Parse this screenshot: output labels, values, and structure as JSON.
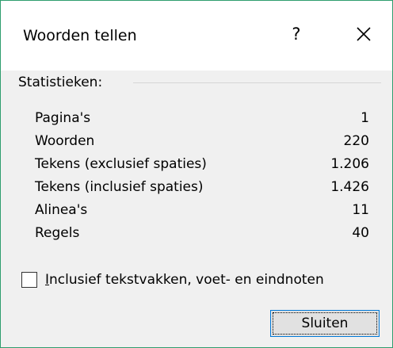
{
  "window": {
    "title": "Woorden tellen",
    "help_label": "?",
    "close_icon": "close-icon"
  },
  "statistics": {
    "heading": "Statistieken:",
    "rows": [
      {
        "label": "Pagina's",
        "value": "1"
      },
      {
        "label": "Woorden",
        "value": "220"
      },
      {
        "label": "Tekens (exclusief spaties)",
        "value": "1.206"
      },
      {
        "label": "Tekens (inclusief spaties)",
        "value": "1.426"
      },
      {
        "label": "Alinea's",
        "value": "11"
      },
      {
        "label": "Regels",
        "value": "40"
      }
    ]
  },
  "options": {
    "include_label_mnemonic": "I",
    "include_label_rest": "nclusief tekstvakken, voet- en eindnoten",
    "include_checked": false
  },
  "buttons": {
    "close_label": "Sluiten"
  },
  "colors": {
    "window_border": "#2f9e6e",
    "dialog_background": "#f0f0f0",
    "button_focus_border": "#0078d7"
  }
}
